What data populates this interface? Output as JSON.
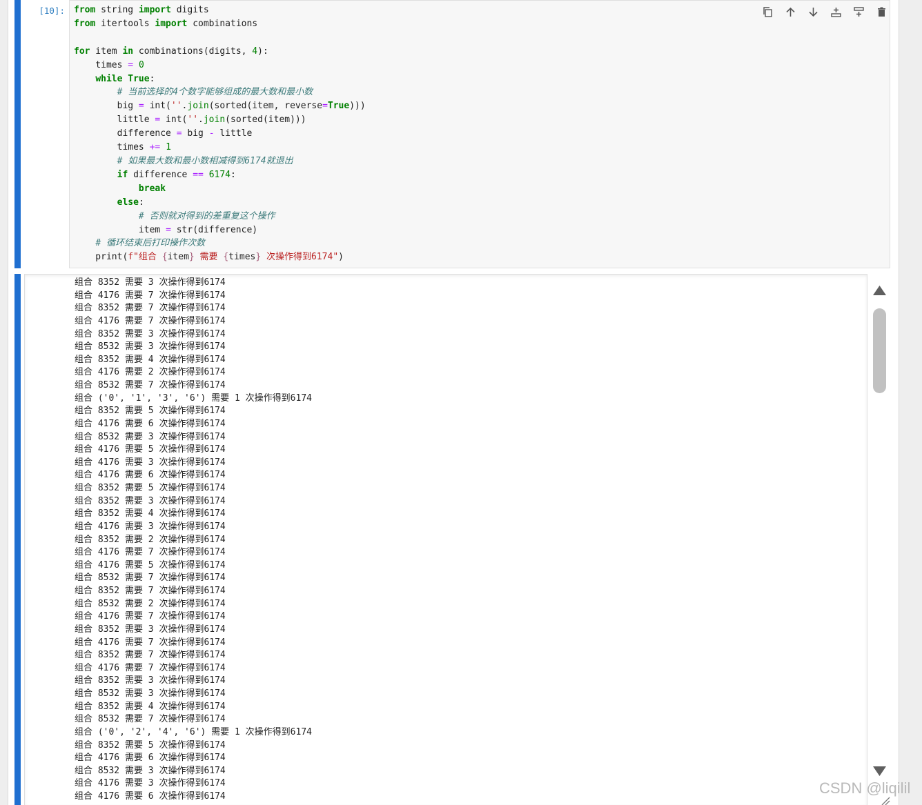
{
  "cell": {
    "prompt": "[10]:",
    "code": [
      [
        [
          "kw",
          "from"
        ],
        [
          "t",
          " string "
        ],
        [
          "kw",
          "import"
        ],
        [
          "t",
          " digits"
        ]
      ],
      [
        [
          "kw",
          "from"
        ],
        [
          "t",
          " itertools "
        ],
        [
          "kw",
          "import"
        ],
        [
          "t",
          " combinations"
        ]
      ],
      [],
      [
        [
          "kw",
          "for"
        ],
        [
          "t",
          " item "
        ],
        [
          "kw",
          "in"
        ],
        [
          "t",
          " combinations(digits, "
        ],
        [
          "num",
          "4"
        ],
        [
          "t",
          "):"
        ]
      ],
      [
        [
          "t",
          "    times "
        ],
        [
          "op",
          "="
        ],
        [
          "t",
          " "
        ],
        [
          "num",
          "0"
        ]
      ],
      [
        [
          "t",
          "    "
        ],
        [
          "kw",
          "while"
        ],
        [
          "t",
          " "
        ],
        [
          "kw",
          "True"
        ],
        [
          "t",
          ":"
        ]
      ],
      [
        [
          "t",
          "        "
        ],
        [
          "cm",
          "# 当前选择的4个数字能够组成的最大数和最小数"
        ]
      ],
      [
        [
          "t",
          "        big "
        ],
        [
          "op",
          "="
        ],
        [
          "t",
          " int("
        ],
        [
          "str",
          "''"
        ],
        [
          "t",
          "."
        ],
        [
          "num",
          "join"
        ],
        [
          "t",
          "(sorted(item, reverse"
        ],
        [
          "op",
          "="
        ],
        [
          "kw",
          "True"
        ],
        [
          "t",
          ")))"
        ]
      ],
      [
        [
          "t",
          "        little "
        ],
        [
          "op",
          "="
        ],
        [
          "t",
          " int("
        ],
        [
          "str",
          "''"
        ],
        [
          "t",
          "."
        ],
        [
          "num",
          "join"
        ],
        [
          "t",
          "(sorted(item)))"
        ]
      ],
      [
        [
          "t",
          "        difference "
        ],
        [
          "op",
          "="
        ],
        [
          "t",
          " big "
        ],
        [
          "op",
          "-"
        ],
        [
          "t",
          " little"
        ]
      ],
      [
        [
          "t",
          "        times "
        ],
        [
          "op",
          "+="
        ],
        [
          "t",
          " "
        ],
        [
          "num",
          "1"
        ]
      ],
      [
        [
          "t",
          "        "
        ],
        [
          "cm",
          "# 如果最大数和最小数相减得到6174就退出"
        ]
      ],
      [
        [
          "t",
          "        "
        ],
        [
          "kw",
          "if"
        ],
        [
          "t",
          " difference "
        ],
        [
          "op",
          "=="
        ],
        [
          "t",
          " "
        ],
        [
          "num",
          "6174"
        ],
        [
          "t",
          ":"
        ]
      ],
      [
        [
          "t",
          "            "
        ],
        [
          "kw",
          "break"
        ]
      ],
      [
        [
          "t",
          "        "
        ],
        [
          "kw",
          "else"
        ],
        [
          "t",
          ":"
        ]
      ],
      [
        [
          "t",
          "            "
        ],
        [
          "cm",
          "# 否则就对得到的差重复这个操作"
        ]
      ],
      [
        [
          "t",
          "            item "
        ],
        [
          "op",
          "="
        ],
        [
          "t",
          " str(difference)"
        ]
      ],
      [
        [
          "t",
          "    "
        ],
        [
          "cm",
          "# 循环结束后打印操作次数"
        ]
      ],
      [
        [
          "t",
          "    print("
        ],
        [
          "fstr",
          "f\"组合 "
        ],
        [
          "interp",
          "{"
        ],
        [
          "t",
          "item"
        ],
        [
          "interp",
          "}"
        ],
        [
          "fstr",
          " 需要 "
        ],
        [
          "interp",
          "{"
        ],
        [
          "t",
          "times"
        ],
        [
          "interp",
          "}"
        ],
        [
          "fstr",
          " 次操作得到6174\""
        ],
        [
          "t",
          ")"
        ]
      ]
    ]
  },
  "toolbar": [
    {
      "name": "duplicate-cell-button",
      "icon": "duplicate-icon"
    },
    {
      "name": "move-cell-up-button",
      "icon": "arrow-up-icon"
    },
    {
      "name": "move-cell-down-button",
      "icon": "arrow-down-icon"
    },
    {
      "name": "insert-cell-above-button",
      "icon": "insert-above-icon"
    },
    {
      "name": "insert-cell-below-button",
      "icon": "insert-below-icon"
    },
    {
      "name": "delete-cell-button",
      "icon": "trash-icon"
    }
  ],
  "output": {
    "lines": [
      "组合 8352 需要 3 次操作得到6174",
      "组合 4176 需要 7 次操作得到6174",
      "组合 8352 需要 7 次操作得到6174",
      "组合 4176 需要 7 次操作得到6174",
      "组合 8352 需要 3 次操作得到6174",
      "组合 8532 需要 3 次操作得到6174",
      "组合 8352 需要 4 次操作得到6174",
      "组合 4176 需要 2 次操作得到6174",
      "组合 8532 需要 7 次操作得到6174",
      "组合 ('0', '1', '3', '6') 需要 1 次操作得到6174",
      "组合 8352 需要 5 次操作得到6174",
      "组合 4176 需要 6 次操作得到6174",
      "组合 8532 需要 3 次操作得到6174",
      "组合 4176 需要 5 次操作得到6174",
      "组合 4176 需要 3 次操作得到6174",
      "组合 4176 需要 6 次操作得到6174",
      "组合 8352 需要 5 次操作得到6174",
      "组合 8352 需要 3 次操作得到6174",
      "组合 8352 需要 4 次操作得到6174",
      "组合 4176 需要 3 次操作得到6174",
      "组合 8352 需要 2 次操作得到6174",
      "组合 4176 需要 7 次操作得到6174",
      "组合 4176 需要 5 次操作得到6174",
      "组合 8532 需要 7 次操作得到6174",
      "组合 8352 需要 7 次操作得到6174",
      "组合 8532 需要 2 次操作得到6174",
      "组合 4176 需要 7 次操作得到6174",
      "组合 8352 需要 3 次操作得到6174",
      "组合 4176 需要 7 次操作得到6174",
      "组合 8352 需要 7 次操作得到6174",
      "组合 4176 需要 7 次操作得到6174",
      "组合 8352 需要 3 次操作得到6174",
      "组合 8532 需要 3 次操作得到6174",
      "组合 8352 需要 4 次操作得到6174",
      "组合 8532 需要 7 次操作得到6174",
      "组合 ('0', '2', '4', '6') 需要 1 次操作得到6174",
      "组合 8352 需要 5 次操作得到6174",
      "组合 4176 需要 6 次操作得到6174",
      "组合 8532 需要 3 次操作得到6174",
      "组合 4176 需要 3 次操作得到6174",
      "组合 4176 需要 6 次操作得到6174"
    ]
  },
  "watermark": "CSDN @liqilil",
  "colors": {
    "cell_bar": "#1f6fd0",
    "keyword": "#008000",
    "operator": "#aa22ff",
    "string": "#ba2121",
    "comment": "#3d7b7b",
    "prompt": "#307fc1"
  }
}
